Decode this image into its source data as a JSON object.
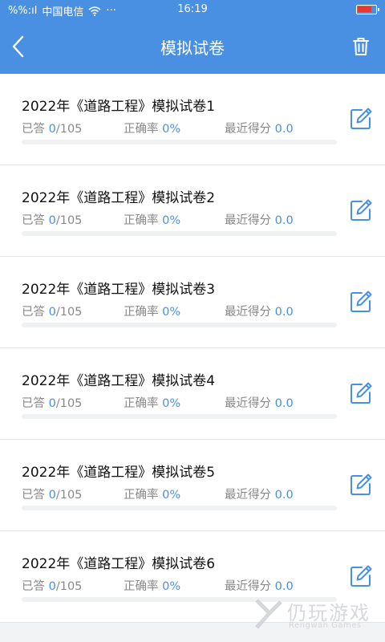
{
  "status_bar": {
    "carrier": "中国电信",
    "signal_text": "%%:ıl",
    "more": "···",
    "time": "16:19",
    "battery_level": 0.85,
    "battery_color": "#e53935"
  },
  "header": {
    "title": "模拟试卷",
    "back_icon": "chevron-left-icon",
    "trash_icon": "trash-icon",
    "background": "#4a90e2"
  },
  "papers": [
    {
      "title": "2022年《道路工程》模拟试卷1",
      "answered_label": "已答 ",
      "answered": "0",
      "total": "/105",
      "accuracy_label": "正确率 ",
      "accuracy": "0%",
      "score_label": "最近得分 ",
      "score": "0.0",
      "progress": 0
    },
    {
      "title": "2022年《道路工程》模拟试卷2",
      "answered_label": "已答 ",
      "answered": "0",
      "total": "/105",
      "accuracy_label": "正确率 ",
      "accuracy": "0%",
      "score_label": "最近得分 ",
      "score": "0.0",
      "progress": 0
    },
    {
      "title": "2022年《道路工程》模拟试卷3",
      "answered_label": "已答 ",
      "answered": "0",
      "total": "/105",
      "accuracy_label": "正确率 ",
      "accuracy": "0%",
      "score_label": "最近得分 ",
      "score": "0.0",
      "progress": 0
    },
    {
      "title": "2022年《道路工程》模拟试卷4",
      "answered_label": "已答 ",
      "answered": "0",
      "total": "/105",
      "accuracy_label": "正确率 ",
      "accuracy": "0%",
      "score_label": "最近得分 ",
      "score": "0.0",
      "progress": 0
    },
    {
      "title": "2022年《道路工程》模拟试卷5",
      "answered_label": "已答 ",
      "answered": "0",
      "total": "/105",
      "accuracy_label": "正确率 ",
      "accuracy": "0%",
      "score_label": "最近得分 ",
      "score": "0.0",
      "progress": 0
    },
    {
      "title": "2022年《道路工程》模拟试卷6",
      "answered_label": "已答 ",
      "answered": "0",
      "total": "/105",
      "accuracy_label": "正确率 ",
      "accuracy": "0%",
      "score_label": "最近得分 ",
      "score": "0.0",
      "progress": 0
    }
  ],
  "edit_icon": "edit-icon",
  "watermark": {
    "text": "仍玩游戏",
    "sub": "Rengwan Games"
  }
}
